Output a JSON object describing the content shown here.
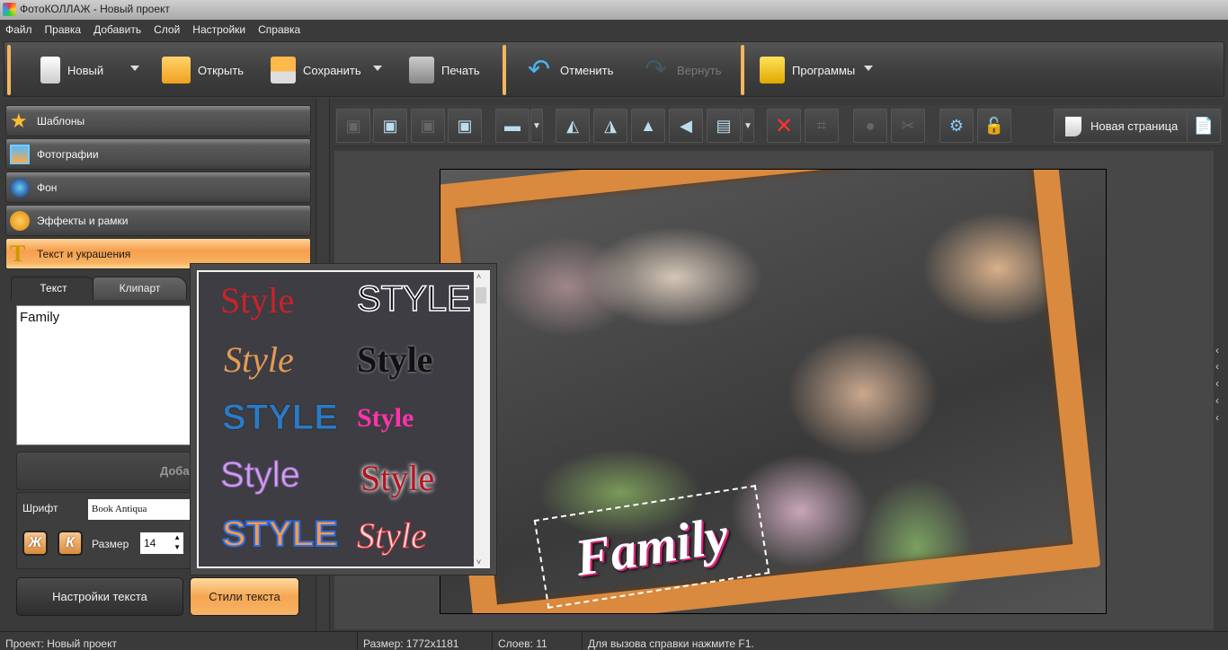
{
  "window": {
    "title": "ФотоКОЛЛАЖ - Новый проект"
  },
  "menu": [
    "Файл",
    "Правка",
    "Добавить",
    "Слой",
    "Настройки",
    "Справка"
  ],
  "toolbar": {
    "new": "Новый",
    "open": "Открыть",
    "save": "Сохранить",
    "print": "Печать",
    "undo": "Отменить",
    "redo": "Вернуть",
    "programs": "Программы"
  },
  "sidebar": {
    "items": [
      {
        "label": "Шаблоны",
        "icon": "star-icon"
      },
      {
        "label": "Фотографии",
        "icon": "photo-icon"
      },
      {
        "label": "Фон",
        "icon": "background-icon"
      },
      {
        "label": "Эффекты и рамки",
        "icon": "palette-icon"
      },
      {
        "label": "Текст и украшения",
        "icon": "text-icon",
        "active": true
      }
    ]
  },
  "tabs": [
    "Текст",
    "Клипарт"
  ],
  "text_panel": {
    "text_value": "Family",
    "add_text": "Добавить текст",
    "font_label": "Шрифт",
    "font_value": "Book Antiqua",
    "bold": "Ж",
    "italic": "К",
    "size_label": "Размер",
    "size_value": "14",
    "settings_button": "Настройки текста",
    "styles_button": "Стили текста"
  },
  "styles_popup": {
    "items": [
      "Style",
      "STYLE",
      "Style",
      "Style",
      "STYLE",
      "Style",
      "Style",
      "Style",
      "STYLE",
      "Style"
    ]
  },
  "canvas_toolbar": {
    "new_page": "Новая страница"
  },
  "canvas": {
    "text_object": "Family"
  },
  "status": {
    "project": "Проект:  Новый проект",
    "size": "Размер:  1772x1181",
    "layers": "Слоев:  11",
    "hint": "Для вызова справки нажмите F1."
  },
  "colors": {
    "accent": "#f6a04e",
    "background": "#3a3a3a"
  }
}
